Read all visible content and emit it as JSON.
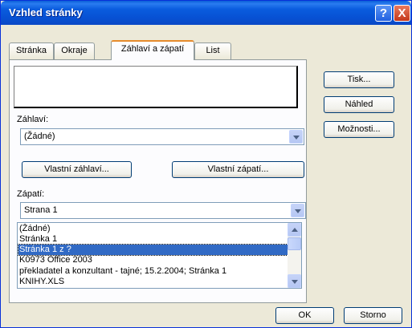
{
  "window": {
    "title": "Vzhled stránky",
    "help_glyph": "?",
    "close_glyph": "X"
  },
  "tabs": [
    {
      "label": "Stránka",
      "active": false
    },
    {
      "label": "Okraje",
      "active": false
    },
    {
      "label": "Záhlaví a zápatí",
      "active": true
    },
    {
      "label": "List",
      "active": false
    }
  ],
  "side_buttons": {
    "print": "Tisk...",
    "preview": "Náhled",
    "options": "Možnosti..."
  },
  "header": {
    "label": "Záhlaví:",
    "value": "(Žádné)",
    "custom_button": "Vlastní záhlaví..."
  },
  "footer": {
    "label": "Zápatí:",
    "value": "Strana 1",
    "custom_button": "Vlastní zápatí...",
    "options": [
      "(Žádné)",
      "Stránka 1",
      "Stránka 1 z ?",
      "K0973 Office 2003",
      "překladatel a konzultant - tajné; 15.2.2004; Stránka 1",
      "KNIHY.XLS"
    ],
    "selected_index": 2
  },
  "dialog_buttons": {
    "ok": "OK",
    "cancel": "Storno"
  },
  "colors": {
    "titlebar": "#0a5cde",
    "selection": "#316ac5",
    "active_tab_accent": "#e68b2c"
  }
}
